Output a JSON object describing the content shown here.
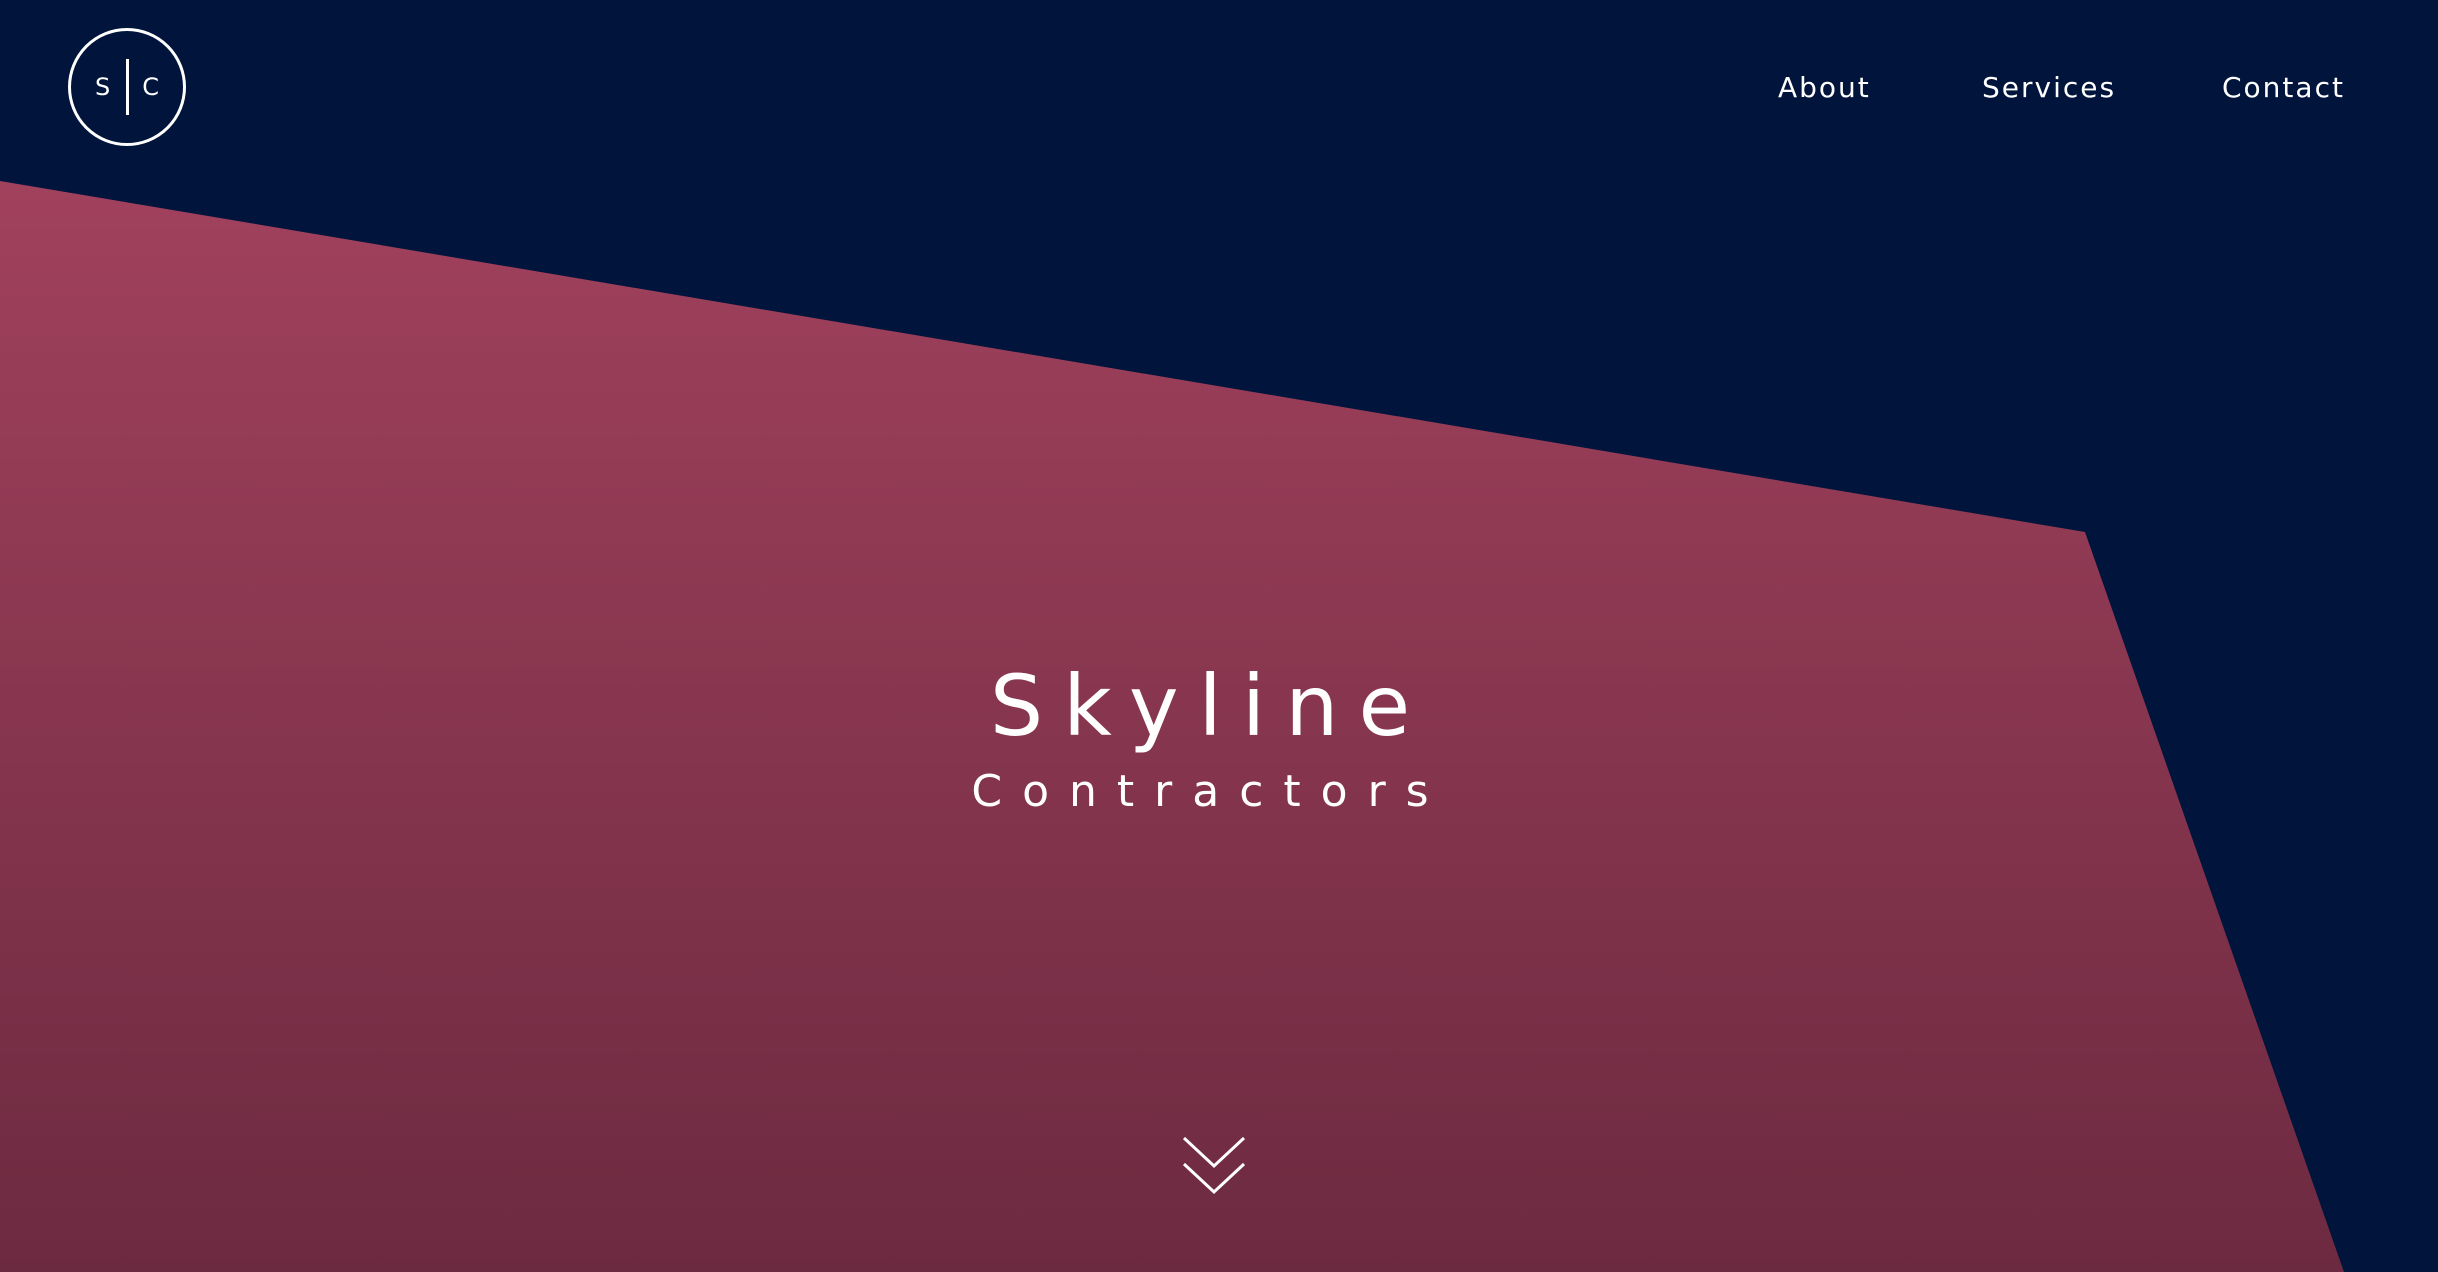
{
  "logo": {
    "left_letter": "S",
    "right_letter": "C"
  },
  "nav": {
    "items": [
      {
        "label": "About"
      },
      {
        "label": "Services"
      },
      {
        "label": "Contact"
      }
    ]
  },
  "hero": {
    "title": "Skyline",
    "subtitle": "Contractors"
  },
  "colors": {
    "background": "#00143c",
    "shape_top": "#a0405c",
    "shape_bottom": "#6c2a40",
    "text": "#ffffff"
  },
  "icons": {
    "scroll": "double-chevron-down-icon"
  }
}
